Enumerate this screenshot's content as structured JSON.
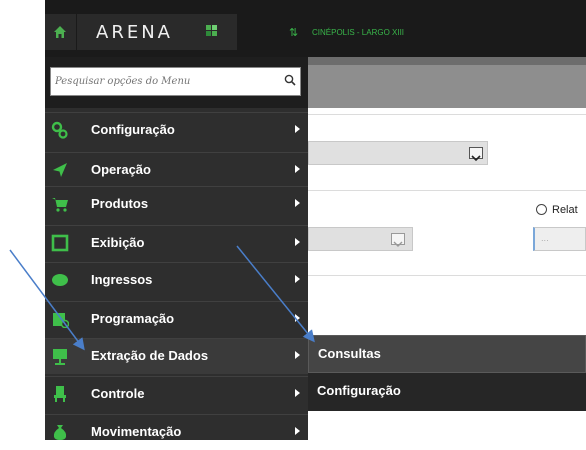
{
  "header": {
    "logo_text": "ARENA",
    "cinema": "CINÉPOLIS - LARGO XIII"
  },
  "search": {
    "placeholder": "Pesquisar opções do Menu"
  },
  "menu": {
    "items": [
      {
        "label": "Configuração",
        "icon": "gears-icon"
      },
      {
        "label": "Operação",
        "icon": "send-arrow-icon"
      },
      {
        "label": "Produtos",
        "icon": "cart-icon"
      },
      {
        "label": "Exibição",
        "icon": "screen-icon"
      },
      {
        "label": "Ingressos",
        "icon": "ticket-icon"
      },
      {
        "label": "Programação",
        "icon": "schedule-icon"
      },
      {
        "label": "Extração de Dados",
        "icon": "presentation-icon"
      },
      {
        "label": "Controle",
        "icon": "chair-icon"
      },
      {
        "label": "Movimentação",
        "icon": "money-bag-icon"
      }
    ]
  },
  "submenu": {
    "items": [
      {
        "label": "Consultas"
      },
      {
        "label": "Configuração"
      }
    ]
  },
  "content": {
    "radio_label": "Relat",
    "input_placeholder": "..."
  },
  "colors": {
    "accent_green": "#39b54a",
    "menu_bg": "#2e2e2e",
    "annotation_arrow": "#4a7ec9"
  }
}
